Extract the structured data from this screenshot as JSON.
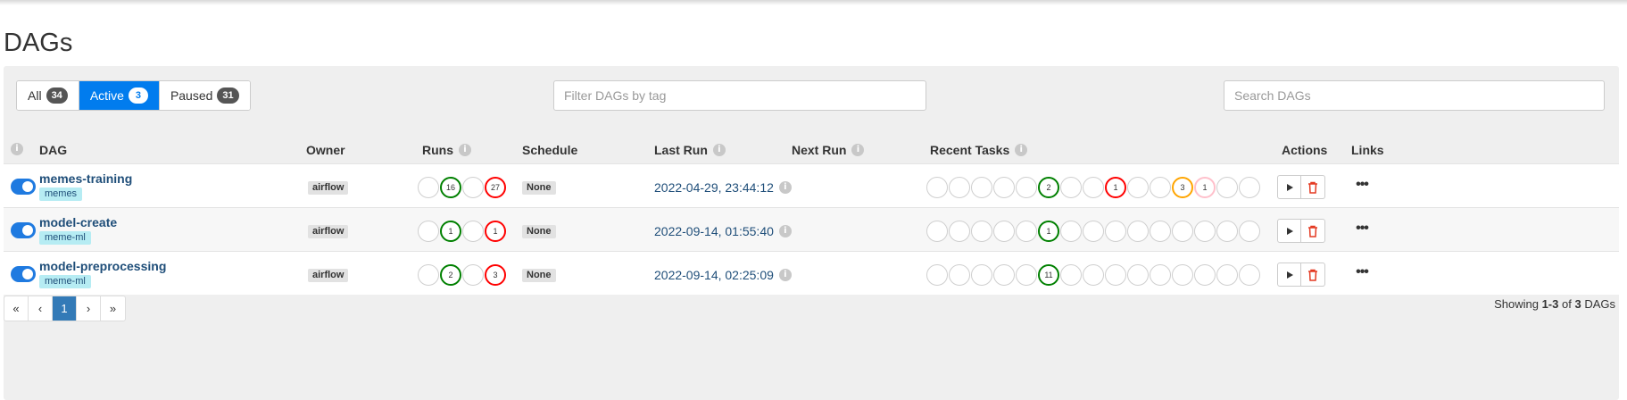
{
  "page": {
    "title": "DAGs"
  },
  "filters": {
    "status": [
      {
        "label": "All",
        "count": "34",
        "active": false
      },
      {
        "label": "Active",
        "count": "3",
        "active": true
      },
      {
        "label": "Paused",
        "count": "31",
        "active": false
      }
    ],
    "tag_placeholder": "Filter DAGs by tag",
    "search_placeholder": "Search DAGs"
  },
  "table": {
    "headers": {
      "info": "i",
      "dag": "DAG",
      "owner": "Owner",
      "runs": "Runs",
      "schedule": "Schedule",
      "last_run": "Last Run",
      "next_run": "Next Run",
      "recent_tasks": "Recent Tasks",
      "actions": "Actions",
      "links": "Links"
    },
    "rows": [
      {
        "name": "memes-training",
        "tag": "memes",
        "owner": "airflow",
        "schedule": "None",
        "last_run": "2022-04-29, 23:44:12",
        "runs": [
          {
            "count": "",
            "color": ""
          },
          {
            "count": "16",
            "color": "#008000"
          },
          {
            "count": "",
            "color": ""
          },
          {
            "count": "27",
            "color": "#ff0000"
          }
        ],
        "recent_tasks": [
          {
            "count": "",
            "color": ""
          },
          {
            "count": "",
            "color": ""
          },
          {
            "count": "",
            "color": ""
          },
          {
            "count": "",
            "color": ""
          },
          {
            "count": "",
            "color": ""
          },
          {
            "count": "2",
            "color": "#008000"
          },
          {
            "count": "",
            "color": ""
          },
          {
            "count": "",
            "color": ""
          },
          {
            "count": "1",
            "color": "#ff0000"
          },
          {
            "count": "",
            "color": ""
          },
          {
            "count": "",
            "color": ""
          },
          {
            "count": "3",
            "color": "#ffa500"
          },
          {
            "count": "1",
            "color": "#ffc0cb"
          },
          {
            "count": "",
            "color": ""
          },
          {
            "count": "",
            "color": ""
          }
        ]
      },
      {
        "name": "model-create",
        "tag": "meme-ml",
        "owner": "airflow",
        "schedule": "None",
        "last_run": "2022-09-14, 01:55:40",
        "runs": [
          {
            "count": "",
            "color": ""
          },
          {
            "count": "1",
            "color": "#008000"
          },
          {
            "count": "",
            "color": ""
          },
          {
            "count": "1",
            "color": "#ff0000"
          }
        ],
        "recent_tasks": [
          {
            "count": "",
            "color": ""
          },
          {
            "count": "",
            "color": ""
          },
          {
            "count": "",
            "color": ""
          },
          {
            "count": "",
            "color": ""
          },
          {
            "count": "",
            "color": ""
          },
          {
            "count": "1",
            "color": "#008000"
          },
          {
            "count": "",
            "color": ""
          },
          {
            "count": "",
            "color": ""
          },
          {
            "count": "",
            "color": ""
          },
          {
            "count": "",
            "color": ""
          },
          {
            "count": "",
            "color": ""
          },
          {
            "count": "",
            "color": ""
          },
          {
            "count": "",
            "color": ""
          },
          {
            "count": "",
            "color": ""
          },
          {
            "count": "",
            "color": ""
          }
        ]
      },
      {
        "name": "model-preprocessing",
        "tag": "meme-ml",
        "owner": "airflow",
        "schedule": "None",
        "last_run": "2022-09-14, 02:25:09",
        "runs": [
          {
            "count": "",
            "color": ""
          },
          {
            "count": "2",
            "color": "#008000"
          },
          {
            "count": "",
            "color": ""
          },
          {
            "count": "3",
            "color": "#ff0000"
          }
        ],
        "recent_tasks": [
          {
            "count": "",
            "color": ""
          },
          {
            "count": "",
            "color": ""
          },
          {
            "count": "",
            "color": ""
          },
          {
            "count": "",
            "color": ""
          },
          {
            "count": "",
            "color": ""
          },
          {
            "count": "11",
            "color": "#008000"
          },
          {
            "count": "",
            "color": ""
          },
          {
            "count": "",
            "color": ""
          },
          {
            "count": "",
            "color": ""
          },
          {
            "count": "",
            "color": ""
          },
          {
            "count": "",
            "color": ""
          },
          {
            "count": "",
            "color": ""
          },
          {
            "count": "",
            "color": ""
          },
          {
            "count": "",
            "color": ""
          },
          {
            "count": "",
            "color": ""
          }
        ]
      }
    ],
    "icons": {
      "trigger": "play-icon",
      "delete": "trash-icon",
      "links": "more-icon"
    },
    "links_glyph": "•••"
  },
  "pagination": {
    "first": "«",
    "prev": "‹",
    "current": "1",
    "next": "›",
    "last": "»"
  },
  "summary": {
    "prefix": "Showing",
    "range": "1-3",
    "of": "of",
    "total": "3",
    "suffix": "DAGs"
  },
  "colors": {
    "accent": "#017cee",
    "link": "#1f4e79",
    "success": "#008000",
    "failed": "#ff0000"
  }
}
